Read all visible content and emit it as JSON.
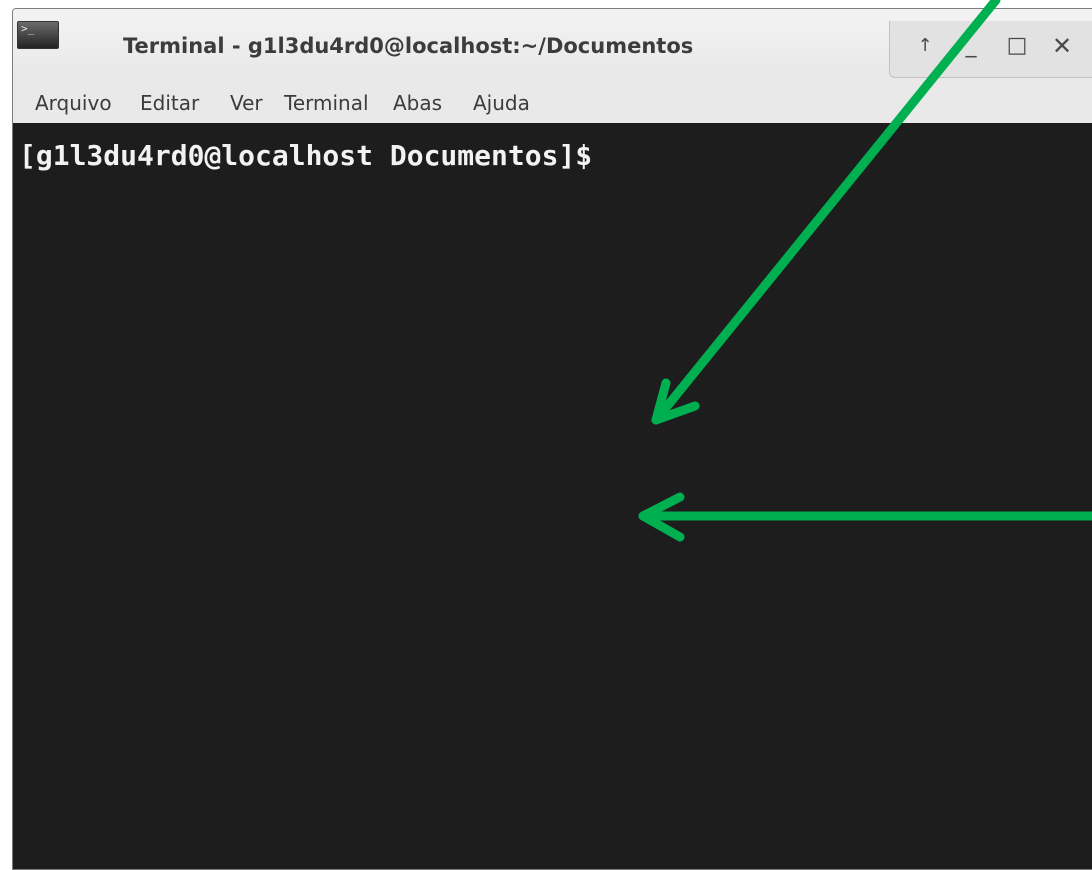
{
  "window": {
    "title": "Terminal - g1l3du4rd0@localhost:~/Documentos",
    "app_icon": "terminal-icon"
  },
  "controls": {
    "up_icon": "↑",
    "minimize_icon": "_",
    "maximize_icon": "□",
    "close_icon": "✕"
  },
  "menu": {
    "items": [
      "Arquivo",
      "Editar",
      "Ver",
      "Terminal",
      "Abas",
      "Ajuda"
    ]
  },
  "terminal": {
    "prompt": "[g1l3du4rd0@localhost Documentos]$"
  },
  "annotation": {
    "arrow_color": "#00b050"
  }
}
